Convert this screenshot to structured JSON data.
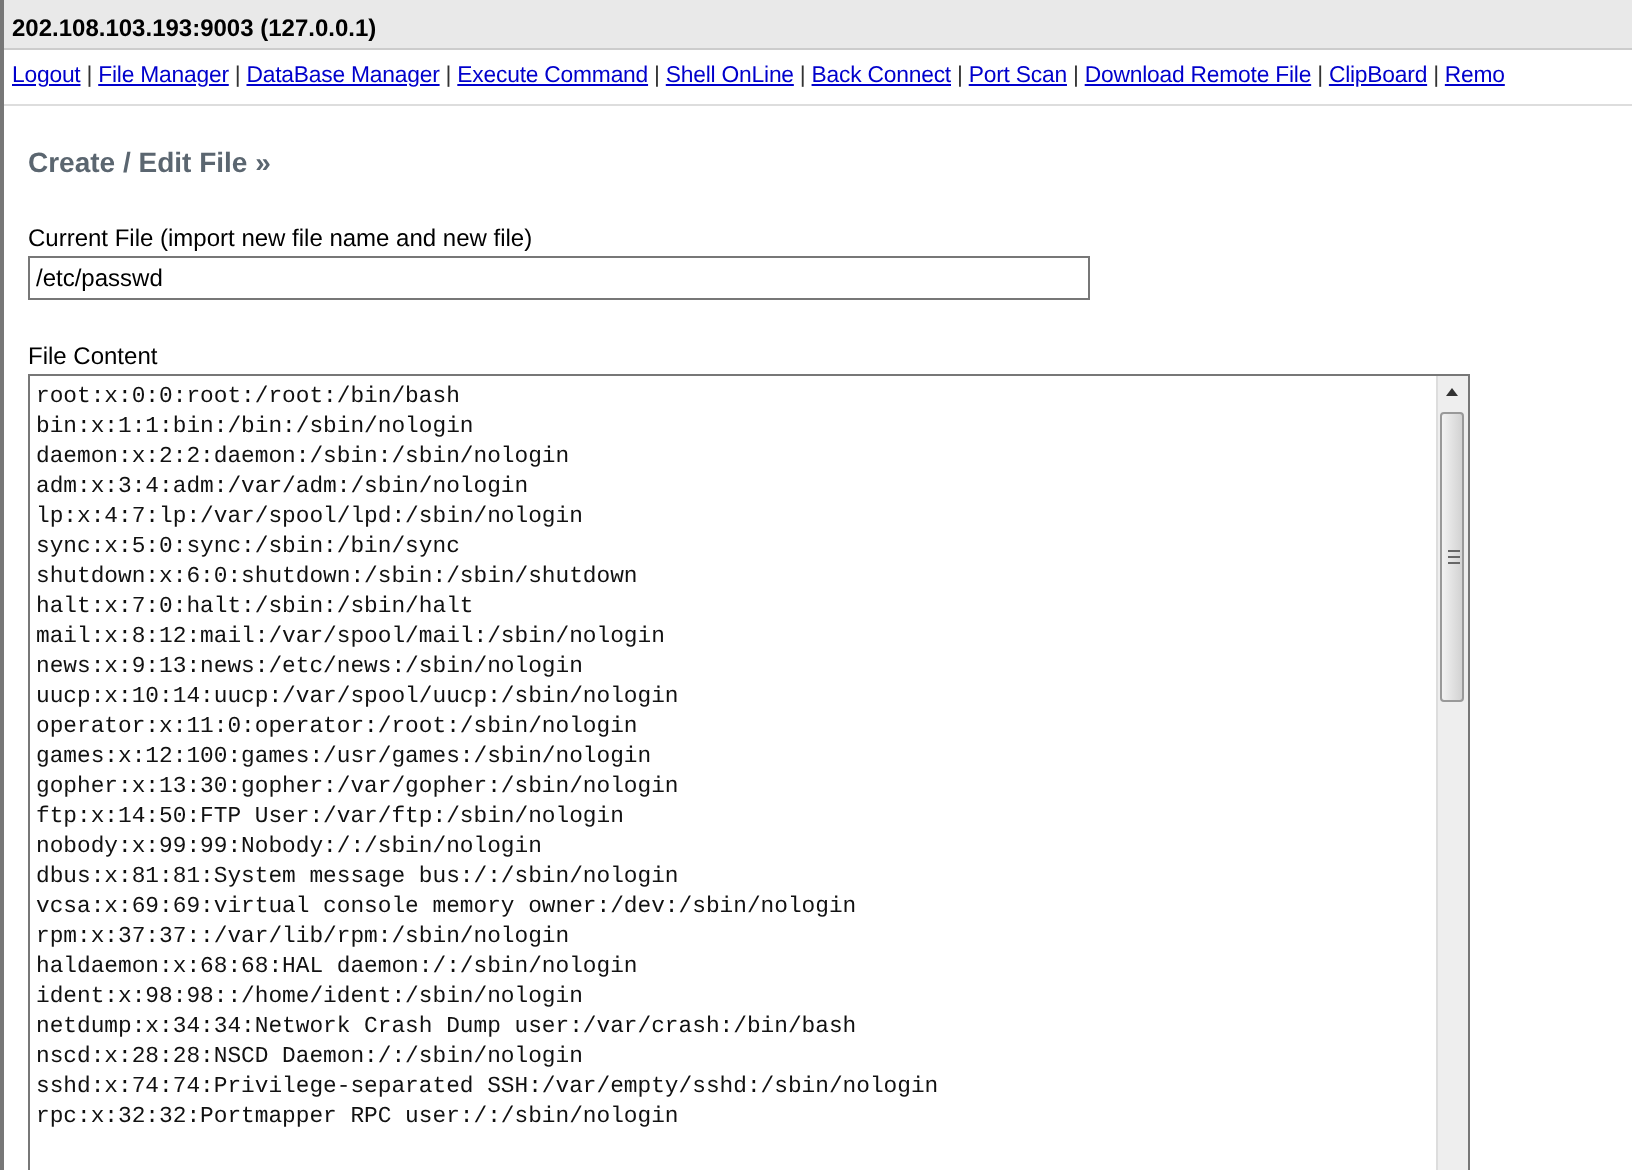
{
  "header": {
    "title": "202.108.103.193:9003 (127.0.0.1)"
  },
  "nav": {
    "links": [
      {
        "label": "Logout",
        "separator": "|"
      },
      {
        "label": "File Manager",
        "separator": "|"
      },
      {
        "label": "DataBase Manager",
        "separator": "|"
      },
      {
        "label": "Execute Command",
        "separator": "|"
      },
      {
        "label": "Shell OnLine",
        "separator": "|"
      },
      {
        "label": "Back Connect",
        "separator": "|"
      },
      {
        "label": "Port Scan",
        "separator": "|"
      },
      {
        "label": "Download Remote File",
        "separator": "|"
      },
      {
        "label": "ClipBoard",
        "separator": "|"
      },
      {
        "label": "Remo"
      }
    ]
  },
  "section": {
    "heading": "Create / Edit File »",
    "current_file": {
      "label": "Current File (import new file name and new file)",
      "value": "/etc/passwd"
    },
    "file_content": {
      "label": "File Content",
      "lines": [
        "root:x:0:0:root:/root:/bin/bash",
        "bin:x:1:1:bin:/bin:/sbin/nologin",
        "daemon:x:2:2:daemon:/sbin:/sbin/nologin",
        "adm:x:3:4:adm:/var/adm:/sbin/nologin",
        "lp:x:4:7:lp:/var/spool/lpd:/sbin/nologin",
        "sync:x:5:0:sync:/sbin:/bin/sync",
        "shutdown:x:6:0:shutdown:/sbin:/sbin/shutdown",
        "halt:x:7:0:halt:/sbin:/sbin/halt",
        "mail:x:8:12:mail:/var/spool/mail:/sbin/nologin",
        "news:x:9:13:news:/etc/news:/sbin/nologin",
        "uucp:x:10:14:uucp:/var/spool/uucp:/sbin/nologin",
        "operator:x:11:0:operator:/root:/sbin/nologin",
        "games:x:12:100:games:/usr/games:/sbin/nologin",
        "gopher:x:13:30:gopher:/var/gopher:/sbin/nologin",
        "ftp:x:14:50:FTP User:/var/ftp:/sbin/nologin",
        "nobody:x:99:99:Nobody:/:/sbin/nologin",
        "dbus:x:81:81:System message bus:/:/sbin/nologin",
        "vcsa:x:69:69:virtual console memory owner:/dev:/sbin/nologin",
        "rpm:x:37:37::/var/lib/rpm:/sbin/nologin",
        "haldaemon:x:68:68:HAL daemon:/:/sbin/nologin",
        "ident:x:98:98::/home/ident:/sbin/nologin",
        "netdump:x:34:34:Network Crash Dump user:/var/crash:/bin/bash",
        "nscd:x:28:28:NSCD Daemon:/:/sbin/nologin",
        "sshd:x:74:74:Privilege-separated SSH:/var/empty/sshd:/sbin/nologin",
        "rpc:x:32:32:Portmapper RPC user:/:/sbin/nologin"
      ]
    }
  }
}
